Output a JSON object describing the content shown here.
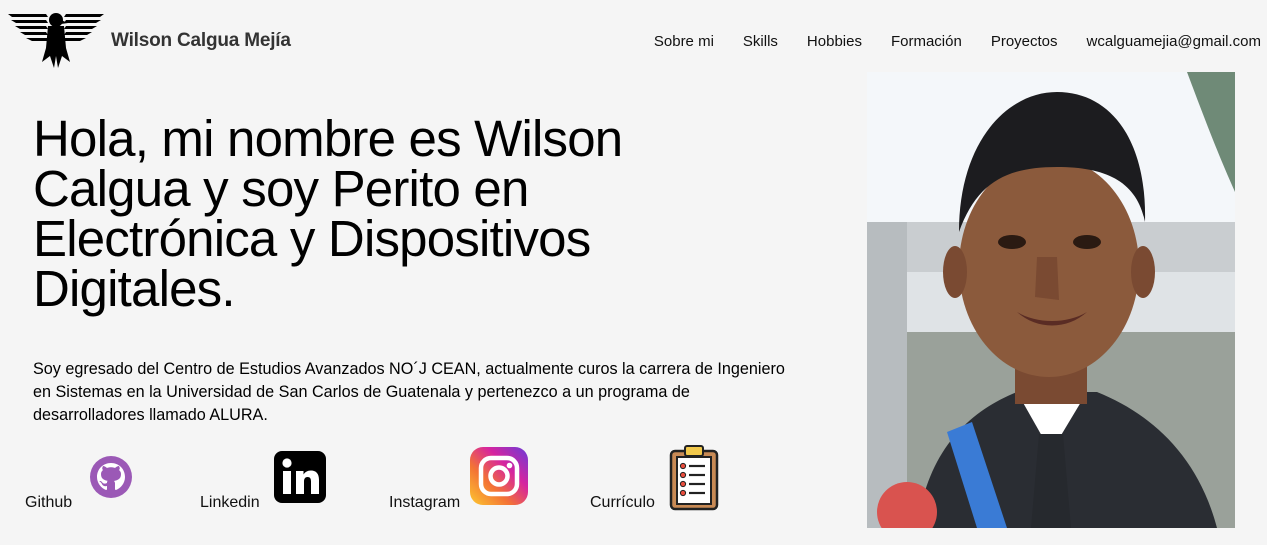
{
  "header": {
    "brand": "Wilson Calgua Mejía",
    "nav": [
      "Sobre mi",
      "Skills",
      "Hobbies",
      "Formación",
      "Proyectos",
      "wcalguamejia@gmail.com"
    ]
  },
  "hero": {
    "title": "Hola, mi nombre es Wilson Calgua y soy Perito en Electrónica y Dispositivos Digitales.",
    "description": "Soy egresado del Centro de Estudios Avanzados NO´J CEAN, actualmente curos la carrera de Ingeniero en Sistemas en la Universidad de San Carlos de Guatenala y pertenezco a un programa de desarrolladores llamado ALURA."
  },
  "social": [
    {
      "label": "Github",
      "icon": "github-icon",
      "color": "#9b59b6"
    },
    {
      "label": "Linkedin",
      "icon": "linkedin-icon",
      "color": "#000000"
    },
    {
      "label": "Instagram",
      "icon": "instagram-icon",
      "color": "#d6249f"
    },
    {
      "label": "Currículo",
      "icon": "clipboard-icon",
      "color": "#6b3e26"
    }
  ]
}
